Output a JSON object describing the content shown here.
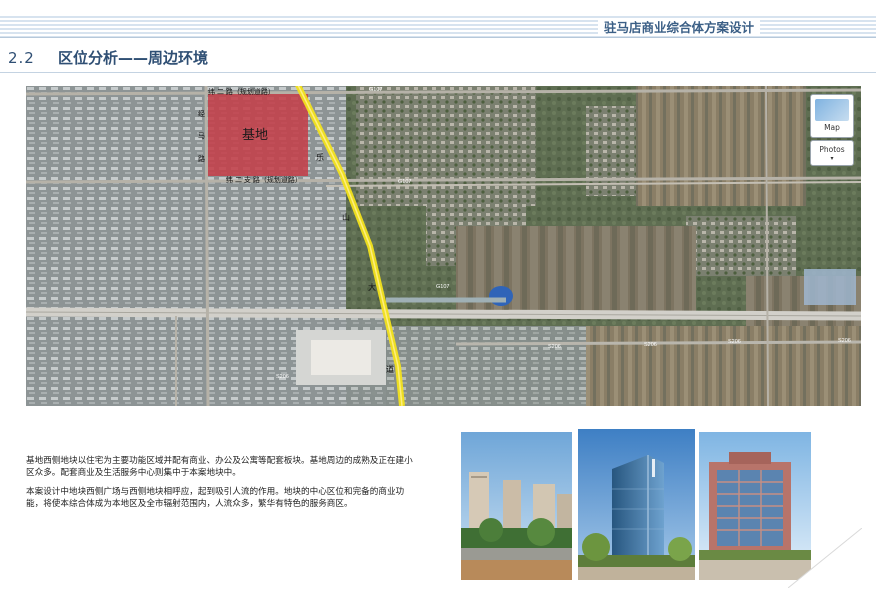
{
  "header": {
    "title": "驻马店商业综合体方案设计"
  },
  "section": {
    "number": "2.2",
    "title": "区位分析——周边环境"
  },
  "map": {
    "site_label": "基地",
    "road_top_label": "纬 二 路（规划道路）",
    "road_bottom_label": "纬 二 支 路（规划道路）",
    "road_left_label_chars": [
      "经",
      "马",
      "路"
    ],
    "avenue_chars": [
      "乐",
      "山",
      "大",
      "道"
    ],
    "highway_labels": [
      "G107",
      "G107",
      "G107"
    ],
    "s206_labels": [
      "S206",
      "S206",
      "S206",
      "S206",
      "S206"
    ],
    "controls": {
      "map_label": "Map",
      "photos_label": "Photos",
      "photos_chevron": "▾"
    },
    "colors": {
      "site": "#c4404a",
      "avenue": "#f2e21c"
    }
  },
  "description": {
    "paragraphs": [
      "基地西侧地块以住宅为主要功能区域并配有商业、办公及公寓等配套板块。基地周边的成熟及正在建小区众多。配套商业及生活服务中心则集中于本案地块中。",
      "本案设计中地块西侧广场与西侧地块相呼应，起到吸引人流的作用。地块的中心区位和完备的商业功能，将使本综合体成为本地区及全市辐射范围内，人流众多，繁华有特色的服务商区。"
    ]
  },
  "photos": [
    {
      "icon": "residential-towers-photo"
    },
    {
      "icon": "glass-office-tower-photo"
    },
    {
      "icon": "hotel-building-photo"
    }
  ]
}
